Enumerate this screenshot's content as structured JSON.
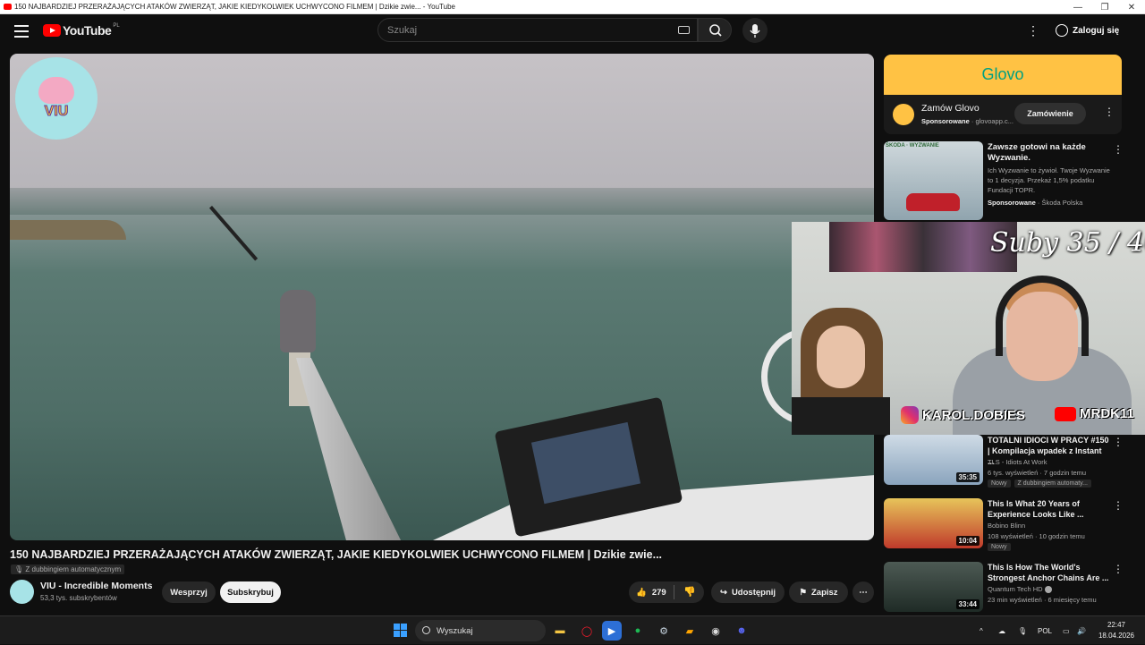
{
  "window": {
    "title": "150 NAJBARDZIEJ PRZERAŻAJĄCYCH ATAKÓW ZWIERZĄT, JAKIE KIEDYKOLWIEK UCHWYCONO FILMEM | Dzikie zwie... - YouTube",
    "minimize": "—",
    "maximize": "❐",
    "close": "✕"
  },
  "masthead": {
    "logo_text": "YouTube",
    "country_code": "PL",
    "search_placeholder": "Szukaj",
    "more_label": "⋮",
    "signin_label": "Zaloguj się"
  },
  "player": {
    "channel_watermark": "VIU"
  },
  "video": {
    "title": "150 NAJBARDZIEJ PRZERAŻAJĄCYCH ATAKÓW ZWIERZĄT, JAKIE KIEDYKOLWIEK UCHWYCONO FILMEM | Dzikie zwie...",
    "dubbing_label": "Z dubbingiem automatycznym",
    "channel_name": "VIU - Incredible Moments",
    "subscribers": "53,3 tys. subskrybentów",
    "join_label": "Wesprzyj",
    "subscribe_label": "Subskrybuj",
    "like_count": "279",
    "share_label": "Udostępnij",
    "save_label": "Zapisz",
    "more_label": "⋯"
  },
  "sidebar": {
    "ad_banner": {
      "brand": "Glovo",
      "title": "Zamów Glovo",
      "sponsored": "Sponsorowane",
      "domain": "· glovoapp.c...",
      "cta": "Zamówienie"
    },
    "ad_skoda": {
      "thumb_label": "ŠKODA · WYZWANIE",
      "title": "Zawsze gotowi na każde Wyzwanie.",
      "description": "Ich Wyzwanie to żywioł. Twoje Wyzwanie to 1 decyzja. Przekaż 1,5% podatku Fundacji TOPR.",
      "sponsored": "Sponsorowane",
      "advertiser": "· Škoda Polska"
    },
    "recommendations": [
      {
        "title": "TOTALNI IDIOCI W PRACY #150 | Kompilacja wpadek z Instant ...",
        "channel": "TLS - Idiots At Work",
        "meta": "6 tys. wyświetleń · 7 godzin temu",
        "badge_new": "Nowy",
        "badge_dub": "Z dubbingiem automaty...",
        "duration": "35:35",
        "colors": [
          "#cfdbe6",
          "#8aa4bd"
        ]
      },
      {
        "title": "This Is What 20 Years of Experience Looks Like ...",
        "channel": "Bobino Blinn",
        "meta": "108 wyświetleń · 10 godzin temu",
        "badge_new": "Nowy",
        "duration": "10:04",
        "colors": [
          "#e7c45a",
          "#c03a2b"
        ]
      },
      {
        "title": "This Is How The World's Strongest Anchor Chains Are ...",
        "channel": "Quantum Tech HD",
        "meta": "23 min wyświetleń · 6 miesięcy temu",
        "duration": "33:44",
        "colors": [
          "#4d5a54",
          "#1f2b26"
        ]
      }
    ]
  },
  "webcam": {
    "sub_counter": "Suby 35 / 40",
    "instagram": "KAROL.DOBIES",
    "youtube": "MRDK11"
  },
  "taskbar": {
    "search_label": "Wyszukaj",
    "language": "POL",
    "time": "22:47",
    "date": "18.04.2026",
    "tray_arrow": "^"
  }
}
